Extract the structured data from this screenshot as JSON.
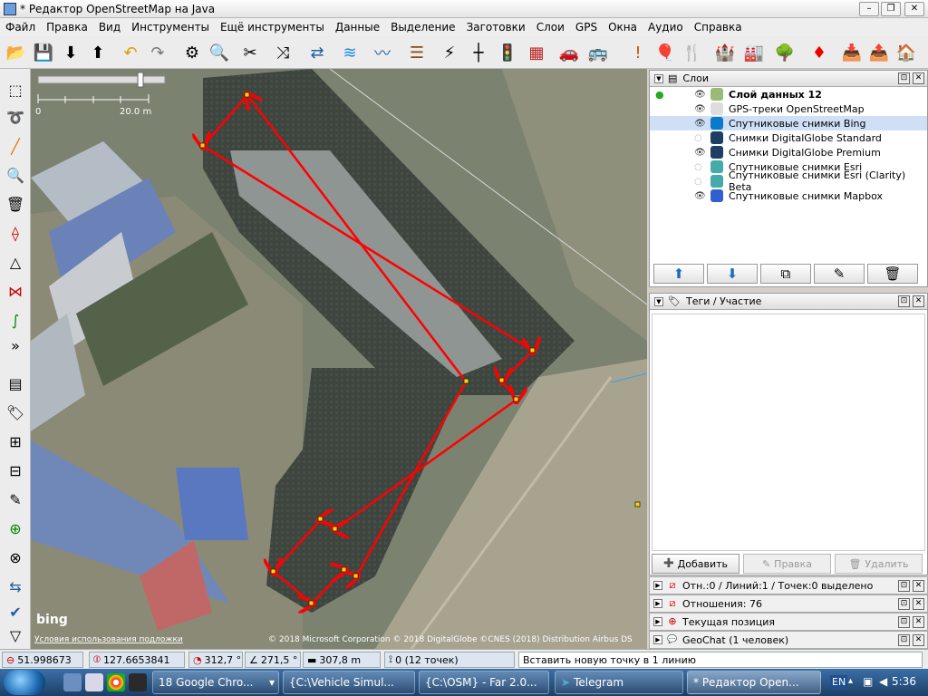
{
  "window": {
    "title": "* Редактор OpenStreetMap на Java"
  },
  "menu": [
    "Файл",
    "Правка",
    "Вид",
    "Инструменты",
    "Ещё инструменты",
    "Данные",
    "Выделение",
    "Заготовки",
    "Слои",
    "GPS",
    "Окна",
    "Аудио",
    "Справка"
  ],
  "map": {
    "scale_start": "0",
    "scale_end": "20.0 m",
    "provider_logo": "bing",
    "terms_link": "Условия использования подложки",
    "attribution": "© 2018 Microsoft Corporation © 2018 DigitalGlobe ©CNES (2018) Distribution Airbus DS"
  },
  "layers_panel": {
    "title": "Слои",
    "items": [
      {
        "name": "Слой данных 12",
        "active": true,
        "visible": true
      },
      {
        "name": "GPS-треки OpenStreetMap",
        "visible": true
      },
      {
        "name": "Спутниковые снимки Bing",
        "visible": true,
        "selected": true
      },
      {
        "name": "Снимки DigitalGlobe Standard",
        "visible": false
      },
      {
        "name": "Снимки DigitalGlobe Premium",
        "visible": true
      },
      {
        "name": "Спутниковые снимки Esri",
        "visible": false
      },
      {
        "name": "Спутниковые снимки Esri (Clarity) Beta",
        "visible": false
      },
      {
        "name": "Спутниковые снимки Mapbox",
        "visible": true
      }
    ]
  },
  "tags_panel": {
    "title": "Теги / Участие",
    "add": "Добавить",
    "edit": "Правка",
    "delete": "Удалить"
  },
  "mini_panels": [
    {
      "label": "Отн.:0 / Линий:1 / Точек:0 выделено"
    },
    {
      "label": "Отношения: 76"
    },
    {
      "label": "Текущая позиция"
    },
    {
      "label": "GeoChat (1 человек)"
    }
  ],
  "status": {
    "lat": "51.998673",
    "lon": "127.6653841",
    "heading": "312,7 °",
    "angle": "271,5 °",
    "length": "307,8 m",
    "nodes": "0 (12 точек)",
    "help": "Вставить новую точку в 1 линию"
  },
  "taskbar": {
    "items": [
      {
        "label": "18 Google Chro..."
      },
      {
        "label": "{C:\\Vehicle Simul..."
      },
      {
        "label": "{C:\\OSM} - Far 2.0..."
      },
      {
        "label": "Telegram"
      },
      {
        "label": "* Редактор Open..."
      }
    ],
    "lang": "EN",
    "clock": "5:36"
  },
  "colors": {
    "way": "#ff0000",
    "node": "#ffd200",
    "selected_layer": "#cfe0f6"
  }
}
